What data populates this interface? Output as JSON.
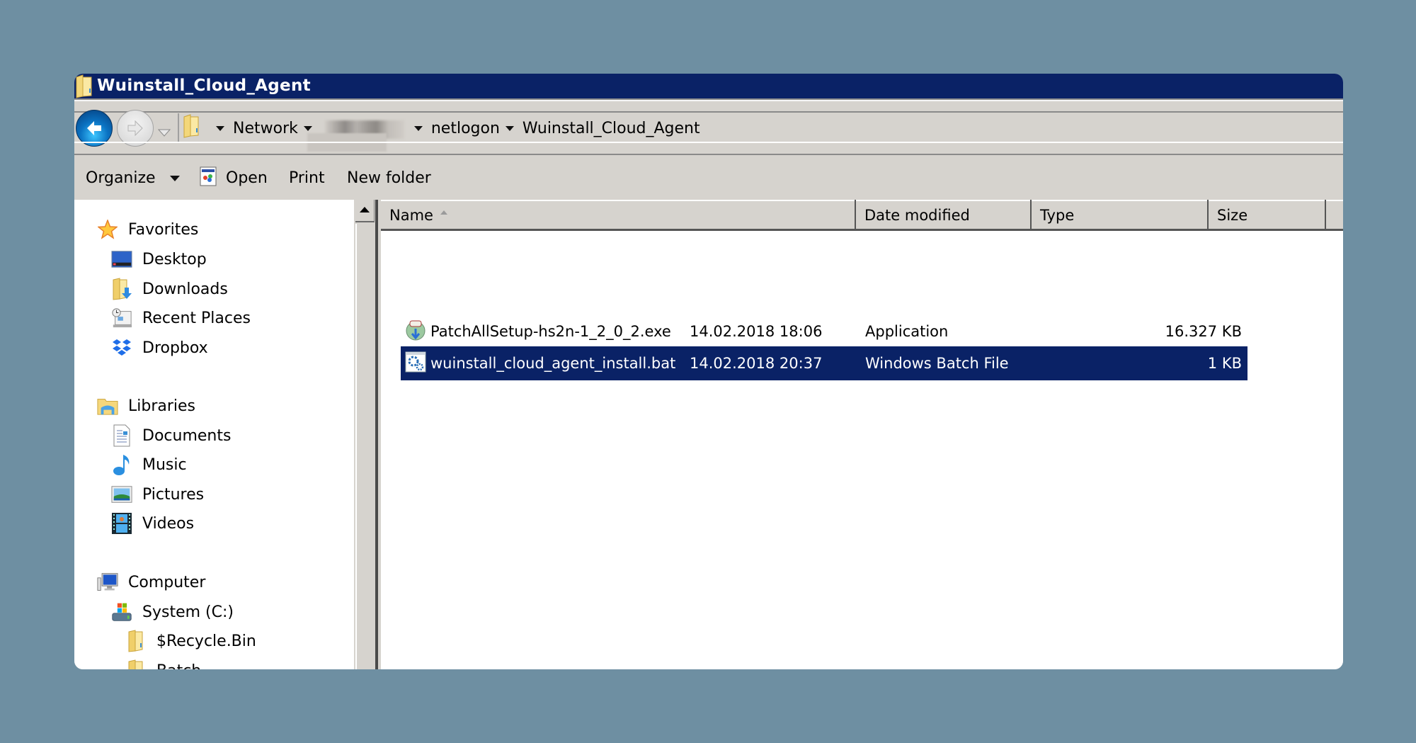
{
  "window": {
    "title": "Wuinstall_Cloud_Agent",
    "title_icon": "folder-icon"
  },
  "navigation": {
    "back_label": "Back",
    "forward_label": "Forward",
    "breadcrumb": [
      {
        "label": "Network"
      },
      {
        "label": "",
        "redacted": true
      },
      {
        "label": "netlogon"
      },
      {
        "label": "Wuinstall_Cloud_Agent"
      }
    ]
  },
  "toolbar": {
    "organize_label": "Organize",
    "open_label": "Open",
    "print_label": "Print",
    "new_folder_label": "New folder"
  },
  "sidebar": {
    "groups": [
      {
        "label": "Favorites",
        "icon": "star-icon",
        "items": [
          {
            "label": "Desktop",
            "icon": "desktop-icon"
          },
          {
            "label": "Downloads",
            "icon": "downloads-icon"
          },
          {
            "label": "Recent Places",
            "icon": "recent-places-icon"
          },
          {
            "label": "Dropbox",
            "icon": "dropbox-icon"
          }
        ]
      },
      {
        "label": "Libraries",
        "icon": "libraries-icon",
        "items": [
          {
            "label": "Documents",
            "icon": "documents-icon"
          },
          {
            "label": "Music",
            "icon": "music-icon"
          },
          {
            "label": "Pictures",
            "icon": "pictures-icon"
          },
          {
            "label": "Videos",
            "icon": "videos-icon"
          }
        ]
      },
      {
        "label": "Computer",
        "icon": "computer-icon",
        "items": [
          {
            "label": "System (C:)",
            "icon": "drive-icon"
          },
          {
            "label": "$Recycle.Bin",
            "icon": "folder-icon"
          },
          {
            "label": "Batch",
            "icon": "folder-icon"
          }
        ]
      }
    ]
  },
  "file_list": {
    "columns": [
      {
        "label": "Name",
        "sorted": "ascending"
      },
      {
        "label": "Date modified"
      },
      {
        "label": "Type"
      },
      {
        "label": "Size"
      }
    ],
    "rows": [
      {
        "name": "PatchAllSetup-hs2n-1_2_0_2.exe",
        "date": "14.02.2018 18:06",
        "type": "Application",
        "size": "16.327 KB",
        "icon": "installer-icon",
        "selected": false
      },
      {
        "name": "wuinstall_cloud_agent_install.bat",
        "date": "14.02.2018 20:37",
        "type": "Windows Batch File",
        "size": "1 KB",
        "icon": "batch-file-icon",
        "selected": true
      }
    ]
  },
  "colors": {
    "titlebar": "#0a2266",
    "selection": "#0a2266",
    "chrome": "#d6d3ce",
    "desktop_background": "#6e8fa2"
  }
}
